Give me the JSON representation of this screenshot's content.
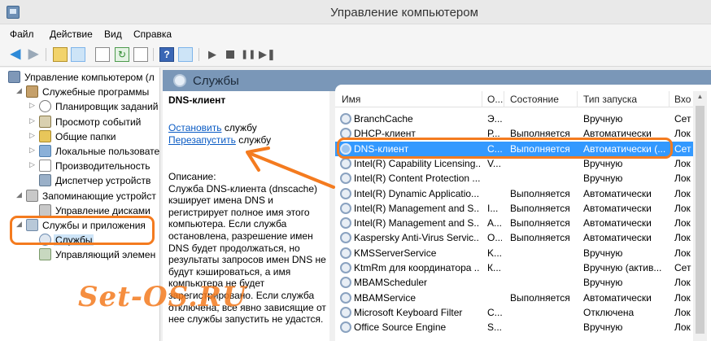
{
  "window": {
    "title": "Управление компьютером"
  },
  "menu": [
    "Файл",
    "Действие",
    "Вид",
    "Справка"
  ],
  "tree": {
    "items": [
      {
        "label": "Управление компьютером (л",
        "level": 0,
        "expander": "",
        "icon": "computer-icon"
      },
      {
        "label": "Служебные программы",
        "level": 1,
        "expander": "◢",
        "icon": "tools-icon"
      },
      {
        "label": "Планировщик заданий",
        "level": 2,
        "expander": "▷",
        "icon": "clock-icon"
      },
      {
        "label": "Просмотр событий",
        "level": 2,
        "expander": "▷",
        "icon": "event-viewer-icon"
      },
      {
        "label": "Общие папки",
        "level": 2,
        "expander": "▷",
        "icon": "shared-folder-icon"
      },
      {
        "label": "Локальные пользовате",
        "level": 2,
        "expander": "▷",
        "icon": "users-icon"
      },
      {
        "label": "Производительность",
        "level": 2,
        "expander": "▷",
        "icon": "performance-icon"
      },
      {
        "label": "Диспетчер устройств",
        "level": 2,
        "expander": "",
        "icon": "device-manager-icon"
      },
      {
        "label": "Запоминающие устройст",
        "level": 1,
        "expander": "◢",
        "icon": "storage-icon"
      },
      {
        "label": "Управление дисками",
        "level": 2,
        "expander": "",
        "icon": "disk-icon"
      },
      {
        "label": "Службы и приложения",
        "level": 1,
        "expander": "◢",
        "icon": "services-apps-icon"
      },
      {
        "label": "Службы",
        "level": 2,
        "expander": "",
        "icon": "gear-icon",
        "selected": true
      },
      {
        "label": "Управляющий элемен",
        "level": 2,
        "expander": "",
        "icon": "wmi-icon"
      }
    ]
  },
  "content": {
    "header_title": "Службы",
    "detail": {
      "service_name": "DNS-клиент",
      "stop_link": "Остановить",
      "stop_suffix": " службу",
      "restart_link": "Перезапустить",
      "restart_suffix": " службу",
      "description": "Описание:\nСлужба DNS-клиента (dnscache) кэширует имена DNS и регистрирует полное имя этого компьютера. Если служба остановлена, разрешение имен DNS будет продолжаться, но результаты запросов имен DNS не будут кэшироваться, а имя компьютера не будет зарегистрировано. Если служба отключена, все явно зависящие от нее службы запустить не удастся."
    },
    "columns": [
      "Имя",
      "О...",
      "Состояние",
      "Тип запуска",
      "Вхо"
    ],
    "rows": [
      {
        "name": "BranchCache",
        "desc": "Э...",
        "state": "",
        "startup": "Вручную",
        "logon": "Сет"
      },
      {
        "name": "DHCP-клиент",
        "desc": "Р...",
        "state": "Выполняется",
        "startup": "Автоматически",
        "logon": "Лок"
      },
      {
        "name": "DNS-клиент",
        "desc": "С...",
        "state": "Выполняется",
        "startup": "Автоматически (...",
        "logon": "Сет",
        "selected": true
      },
      {
        "name": "Intel(R) Capability Licensing...",
        "desc": "V...",
        "state": "",
        "startup": "Вручную",
        "logon": "Лок"
      },
      {
        "name": "Intel(R) Content Protection ...",
        "desc": "",
        "state": "",
        "startup": "Вручную",
        "logon": "Лок"
      },
      {
        "name": "Intel(R) Dynamic Applicatio...",
        "desc": "",
        "state": "Выполняется",
        "startup": "Автоматически",
        "logon": "Лок"
      },
      {
        "name": "Intel(R) Management and S...",
        "desc": "I...",
        "state": "Выполняется",
        "startup": "Автоматически",
        "logon": "Лок"
      },
      {
        "name": "Intel(R) Management and S...",
        "desc": "A...",
        "state": "Выполняется",
        "startup": "Автоматически",
        "logon": "Лок"
      },
      {
        "name": "Kaspersky Anti-Virus Servic...",
        "desc": "О...",
        "state": "Выполняется",
        "startup": "Автоматически",
        "logon": "Лок"
      },
      {
        "name": "KMSServerService",
        "desc": "K...",
        "state": "",
        "startup": "Вручную",
        "logon": "Лок"
      },
      {
        "name": "KtmRm для координатора ...",
        "desc": "К...",
        "state": "",
        "startup": "Вручную (актив...",
        "logon": "Сет"
      },
      {
        "name": "MBAMScheduler",
        "desc": "",
        "state": "",
        "startup": "Вручную",
        "logon": "Лок"
      },
      {
        "name": "MBAMService",
        "desc": "",
        "state": "Выполняется",
        "startup": "Автоматически",
        "logon": "Лок"
      },
      {
        "name": "Microsoft Keyboard Filter",
        "desc": "C...",
        "state": "",
        "startup": "Отключена",
        "logon": "Лок"
      },
      {
        "name": "Office Source Engine",
        "desc": "S...",
        "state": "",
        "startup": "Вручную",
        "logon": "Лок"
      }
    ]
  },
  "watermark": "Set-OS.RU",
  "colors": {
    "accent": "#f47b1f",
    "header": "#7a97b8",
    "selection": "#3399ff",
    "link": "#0a5bc4"
  }
}
